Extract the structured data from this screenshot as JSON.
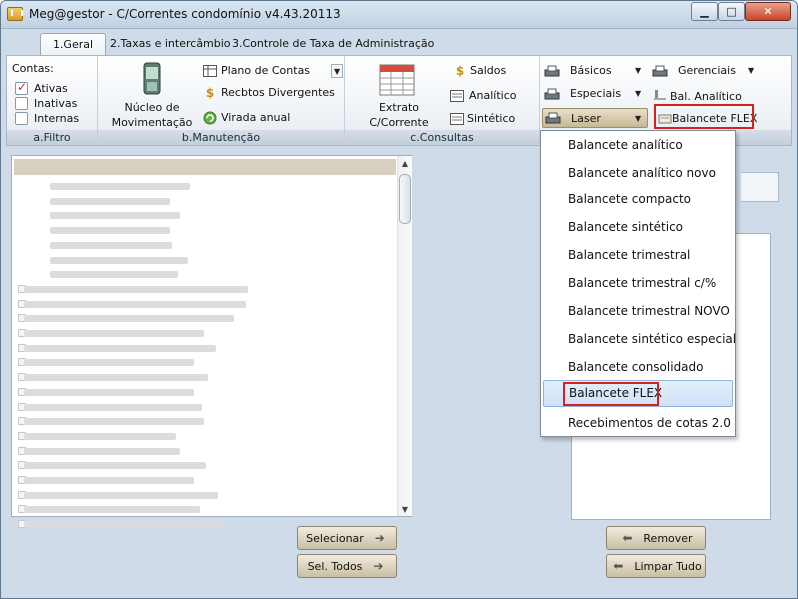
{
  "window": {
    "title": "Meg@gestor - C/Correntes condomínio v4.43.20113"
  },
  "tabs": [
    "1.Geral",
    "2.Taxas e intercâmbio",
    "3.Controle de Taxa de Administração"
  ],
  "filtro": {
    "label": "Contas:",
    "checks": [
      {
        "label": "Ativas",
        "checked": true
      },
      {
        "label": "Inativas",
        "checked": false
      },
      {
        "label": "Internas",
        "checked": false
      }
    ],
    "group_label": "a.Filtro"
  },
  "manutencao": {
    "nucleo": "Núcleo de Movimentação",
    "items": [
      "Plano de Contas",
      "Recbtos Divergentes",
      "Virada anual"
    ],
    "group_label": "b.Manutenção"
  },
  "consultas": {
    "extrato": "Extrato C/Corrente",
    "items": [
      "Saldos",
      "Analítico",
      "Sintético"
    ],
    "group_label": "c.Consultas"
  },
  "reports": {
    "basicos": "Básicos",
    "especiais": "Especiais",
    "laser": "Laser",
    "gerenciais": "Gerenciais",
    "bal_analitico": "Bal. Analítico",
    "balancete_flex": "Balancete FLEX"
  },
  "laser_menu": [
    "Balancete analítico",
    "Balancete analítico novo",
    "Balancete compacto",
    "Balancete sintético",
    "Balancete trimestral",
    "Balancete trimestral c/%",
    "Balancete trimestral NOVO",
    "Balancete sintético especial",
    "Balancete consolidado",
    "Balancete FLEX",
    "Recebimentos de cotas 2.0"
  ],
  "highlighted_menu_item": "Balancete FLEX",
  "buttons": {
    "selecionar": "Selecionar",
    "sel_todos": "Sel. Todos",
    "remover": "Remover",
    "limpar_tudo": "Limpar Tudo"
  },
  "colors": {
    "highlight_border": "#d62020",
    "menu_hover": "#cde1f6"
  }
}
